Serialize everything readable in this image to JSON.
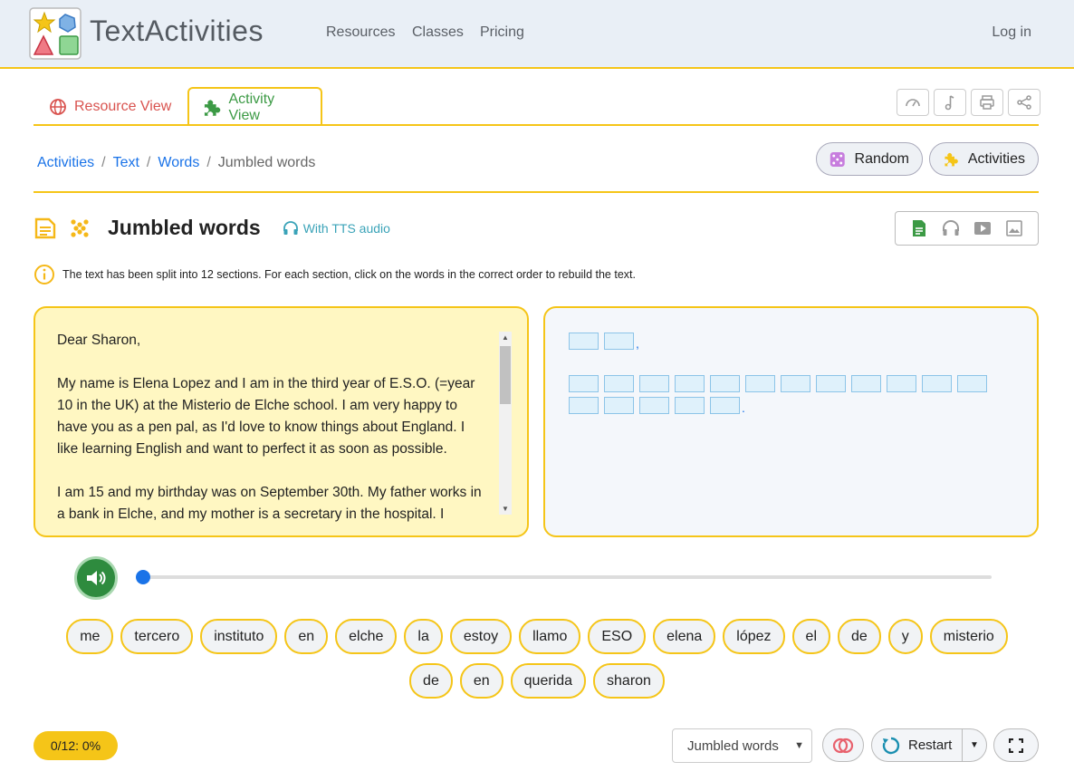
{
  "navbar": {
    "brand": "TextActivities",
    "links": [
      "Resources",
      "Classes",
      "Pricing"
    ],
    "login": "Log in"
  },
  "tabs": {
    "resource": "Resource View",
    "activity": "Activity View"
  },
  "toolbar_icons": [
    "speedometer-icon",
    "music-note-icon",
    "printer-icon",
    "share-icon"
  ],
  "breadcrumb": {
    "items": [
      "Activities",
      "Text",
      "Words"
    ],
    "current": "Jumbled words"
  },
  "buttons": {
    "random": "Random",
    "activities": "Activities",
    "restart": "Restart"
  },
  "activity": {
    "title": "Jumbled words",
    "tts_label": "With TTS audio",
    "info": "The text has been split into 12 sections. For each section, click on the words in the correct order to rebuild the text."
  },
  "text_panel": {
    "paragraphs": [
      "Dear Sharon,",
      "My name is Elena Lopez and I am in the third year of E.S.O. (=year 10 in the UK) at the Misterio de Elche school. I am very happy to have you as a pen pal, as I'd love to know things about England. I like learning English and want to perfect it as soon as possible.",
      "I am 15 and my birthday was on September 30th. My father works in a bank in Elche, and my mother is a secretary in the hospital. I"
    ]
  },
  "answer_panel": {
    "rows": [
      {
        "slots": 2,
        "punct": ","
      },
      {
        "slots": 12,
        "punct": ""
      },
      {
        "slots": 5,
        "punct": "."
      }
    ]
  },
  "audio": {
    "progress": 0
  },
  "words": [
    "me",
    "tercero",
    "instituto",
    "en",
    "elche",
    "la",
    "estoy",
    "llamo",
    "ESO",
    "elena",
    "lópez",
    "el",
    "de",
    "y",
    "misterio",
    "de",
    "en",
    "querida",
    "sharon"
  ],
  "footer": {
    "score": "0/12: 0%",
    "mode_select": "Jumbled words"
  },
  "colors": {
    "accent": "#f5c518",
    "link": "#1a73e8",
    "resource_tab": "#d9534f",
    "activity_tab": "#3c9a45",
    "play_button": "#2e8b3e"
  }
}
